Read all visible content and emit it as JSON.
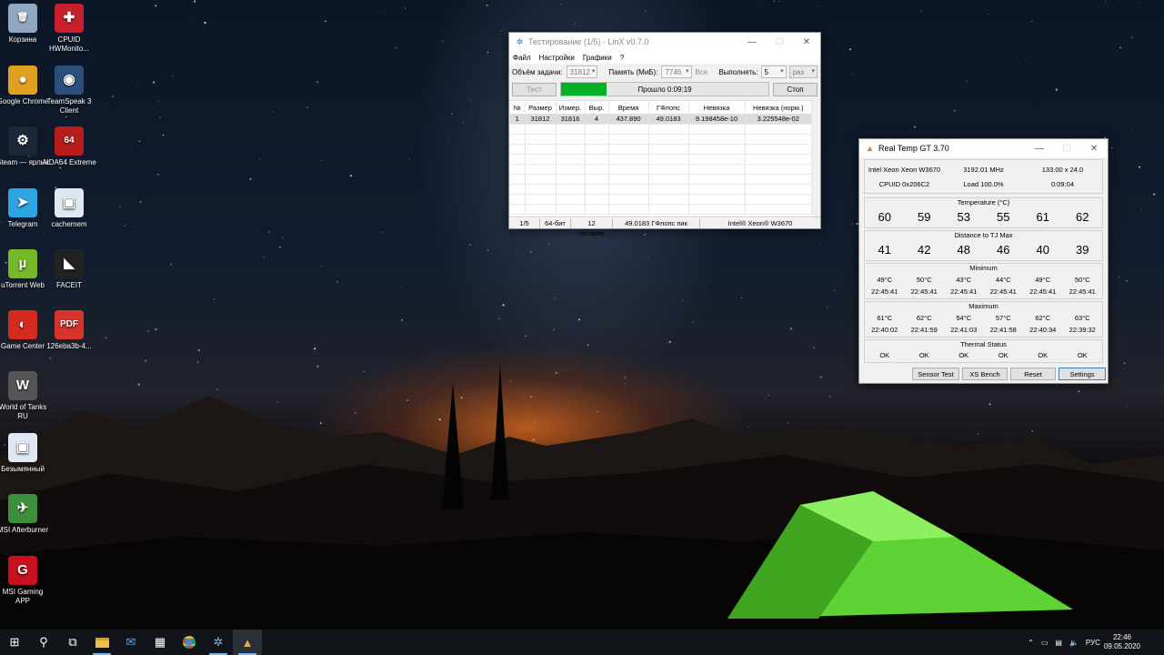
{
  "desktop_icons": [
    {
      "label": "Корзина",
      "icon": "recycle-bin-icon",
      "color": "#8fa7bf"
    },
    {
      "label": "CPUID HWMonito...",
      "icon": "hwmonitor-icon",
      "color": "#c8202c"
    },
    {
      "label": "Google Chrome",
      "icon": "chrome-icon",
      "color": "#e0a020"
    },
    {
      "label": "TeamSpeak 3 Client",
      "icon": "teamspeak-icon",
      "color": "#2b4f7a"
    },
    {
      "label": "Steam — ярлык",
      "icon": "steam-icon",
      "color": "#1b2838"
    },
    {
      "label": "AIDA64 Extreme",
      "icon": "aida64-icon",
      "color": "#b81d1d"
    },
    {
      "label": "Telegram",
      "icon": "telegram-icon",
      "color": "#2ca5e0"
    },
    {
      "label": "cachemem",
      "icon": "image-file-icon",
      "color": "#dfe8f2"
    },
    {
      "label": "uTorrent Web",
      "icon": "utorrent-icon",
      "color": "#76b82a"
    },
    {
      "label": "FACEIT",
      "icon": "faceit-icon",
      "color": "#222222"
    },
    {
      "label": "Game Center",
      "icon": "game-center-icon",
      "color": "#d52b1e"
    },
    {
      "label": "126eba3b-4...",
      "icon": "pdf-icon",
      "color": "#d8342c"
    },
    {
      "label": "World of Tanks RU",
      "icon": "world-of-tanks-icon",
      "color": "#555555"
    },
    {
      "label": "Безымянный",
      "icon": "image-file-icon",
      "color": "#dfe8f2"
    },
    {
      "label": "MSI Afterburner",
      "icon": "afterburner-icon",
      "color": "#3c8f3c"
    },
    {
      "label": "MSI Gaming APP",
      "icon": "msi-gaming-icon",
      "color": "#c8101e"
    }
  ],
  "linx": {
    "title": "Тестирование (1/5) - LinX v0.7.0",
    "menu": [
      "Файл",
      "Настройки",
      "Графики",
      "?"
    ],
    "task_size_label": "Объём задачи:",
    "task_size_value": "31812",
    "memory_label": "Память (МиБ):",
    "memory_value": "7746",
    "all_label": "Все",
    "run_label": "Выполнять:",
    "run_value": "5",
    "times_value": "раз",
    "test_button": "Тест",
    "progress_text": "Прошло 0:09:19",
    "progress_fraction": 0.22,
    "stop_button": "Стоп",
    "columns": [
      "№",
      "Размер",
      "Измер.",
      "Выр.",
      "Время",
      "ГФлопс",
      "Невязка",
      "Невязка (норм.)"
    ],
    "rows": [
      [
        "1",
        "31812",
        "31816",
        "4",
        "437.890",
        "49.0183",
        "9.198458e-10",
        "3.225548e-02"
      ]
    ],
    "status": [
      "1/5",
      "64-бит",
      "12 потоков",
      "49.0183 ГФлопс пик",
      "Intel® Xeon® W3670"
    ]
  },
  "realtemp": {
    "title": "Real Temp GT 3.70",
    "cpu_name": "Intel Xeon Xeon W3670",
    "frequency": "3192.01 MHz",
    "multiplier": "133.00 x 24.0",
    "cpuid": "CPUID  0x206C2",
    "load": "Load 100.0%",
    "uptime": "0:09:04",
    "temperature_label": "Temperature (°C)",
    "temperatures": [
      "60",
      "59",
      "53",
      "55",
      "61",
      "62"
    ],
    "distance_label": "Distance to TJ Max",
    "distances": [
      "41",
      "42",
      "48",
      "46",
      "40",
      "39"
    ],
    "minimum_label": "Minimum",
    "minimum_temps": [
      "49°C",
      "50°C",
      "43°C",
      "44°C",
      "49°C",
      "50°C"
    ],
    "minimum_times": [
      "22:45:41",
      "22:45:41",
      "22:45:41",
      "22:45:41",
      "22:45:41",
      "22:45:41"
    ],
    "maximum_label": "Maximum",
    "maximum_temps": [
      "61°C",
      "62°C",
      "54°C",
      "57°C",
      "62°C",
      "63°C"
    ],
    "maximum_times": [
      "22:40:02",
      "22:41:59",
      "22:41:03",
      "22:41:58",
      "22:40:34",
      "22:39:32"
    ],
    "thermal_label": "Thermal Status",
    "thermal_status": [
      "OK",
      "OK",
      "OK",
      "OK",
      "OK",
      "OK"
    ],
    "buttons": [
      "Sensor Test",
      "XS Bench",
      "Reset",
      "Settings"
    ]
  },
  "taskbar": {
    "items": [
      "start-icon",
      "search-icon",
      "task-view-icon",
      "file-explorer-icon",
      "mail-icon",
      "calculator-icon",
      "chrome-icon",
      "linx-icon",
      "realtemp-icon"
    ],
    "language": "РУС",
    "time": "22:46",
    "date": "09.05.2020"
  },
  "colors": {
    "progress_green": "#06b025",
    "taskbar_bg": "#111418",
    "settings_border": "#3c7fb1"
  }
}
